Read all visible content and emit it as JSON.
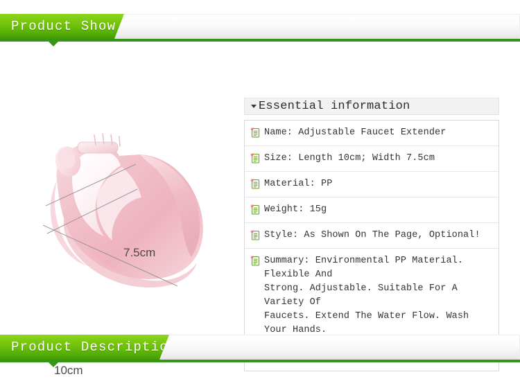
{
  "sections": {
    "product_show": {
      "tab_label": "Product Show",
      "accent_color": "#6cc00b",
      "rule_color": "#37951a"
    },
    "product_description": {
      "tab_label": "Product Description",
      "accent_color": "#6cc00b",
      "rule_color": "#37951a"
    }
  },
  "product_image": {
    "alt_name": "pink-adjustable-faucet-extender",
    "body_color": "#f3c3cb",
    "highlight_color": "#fbe3e8",
    "dimensions": {
      "width_label": "7.5cm",
      "length_label": "10cm"
    }
  },
  "info_panel": {
    "title": "Essential information",
    "rows": [
      {
        "icon": "note-icon",
        "text": "Name: Adjustable Faucet Extender"
      },
      {
        "icon": "note-icon",
        "text": "Size: Length 10cm; Width 7.5cm"
      },
      {
        "icon": "note-icon",
        "text": "Material: PP"
      },
      {
        "icon": "note-icon",
        "text": "Weight: 15g"
      },
      {
        "icon": "note-icon",
        "text": "Style: As Shown On The Page, Optional!"
      },
      {
        "icon": "note-icon",
        "text": "Summary: Environmental PP Material. Flexible And\nStrong. Adjustable. Suitable For A Variety Of\nFaucets. Extend The Water Flow. Wash Your Hands.\nLet Your Baby Love To Clean From Childhood!"
      }
    ]
  }
}
